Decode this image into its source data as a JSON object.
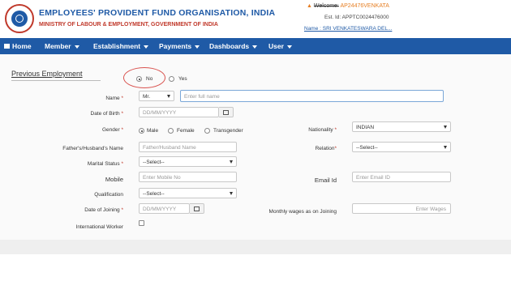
{
  "header": {
    "org_title": "EMPLOYEES' PROVIDENT FUND ORGANISATION, INDIA",
    "org_subtitle": "MINISTRY OF LABOUR & EMPLOYMENT, GOVERNMENT OF INDIA",
    "welcome_label": "Welcome:",
    "welcome_value": "AP24476VENKATA",
    "est_id": "Est. Id: APPTC0024476000",
    "user_name": "Name : SRI VENKATESWARA DEL..."
  },
  "nav": {
    "items": [
      {
        "label": "Home",
        "icon": "home-icon",
        "has_caret": false
      },
      {
        "label": "Member",
        "has_caret": true
      },
      {
        "label": "Establishment",
        "has_caret": true
      },
      {
        "label": "Payments",
        "has_caret": true
      },
      {
        "label": "Dashboards",
        "has_caret": true
      },
      {
        "label": "User",
        "has_caret": true
      }
    ]
  },
  "form": {
    "section_title": "Previous Employment",
    "previous_employment": {
      "options": [
        "No",
        "Yes"
      ],
      "selected": "No"
    },
    "name_label": "Name",
    "salutation_value": "Mr.",
    "name_placeholder": "Enter full name",
    "dob_label": "Date of Birth",
    "dob_placeholder": "DD/MM/YYYY",
    "gender_label": "Gender",
    "gender_options": [
      "Male",
      "Female",
      "Transgender"
    ],
    "gender_selected": "Male",
    "nationality_label": "Nationality",
    "nationality_value": "INDIAN",
    "father_label": "Father's/Husband's Name",
    "father_placeholder": "Father/Husband Name",
    "relation_label": "Relation",
    "relation_value": "--Select--",
    "marital_label": "Marital Status",
    "marital_value": "--Select--",
    "mobile_label": "Mobile",
    "mobile_placeholder": "Enter Mobile No",
    "email_label": "Email Id",
    "email_placeholder": "Enter Email ID",
    "qualification_label": "Qualification",
    "qualification_value": "--Select--",
    "doj_label": "Date of Joining",
    "doj_placeholder": "DD/MM/YYYY",
    "wages_label": "Monthly wages as on Joining",
    "wages_placeholder": "Enter Wages",
    "intl_label": "International Worker",
    "required_marker": "*"
  },
  "colors": {
    "brand_blue": "#1f5aa6",
    "accent_red": "#c0392b",
    "annotation": "#d9534f"
  }
}
